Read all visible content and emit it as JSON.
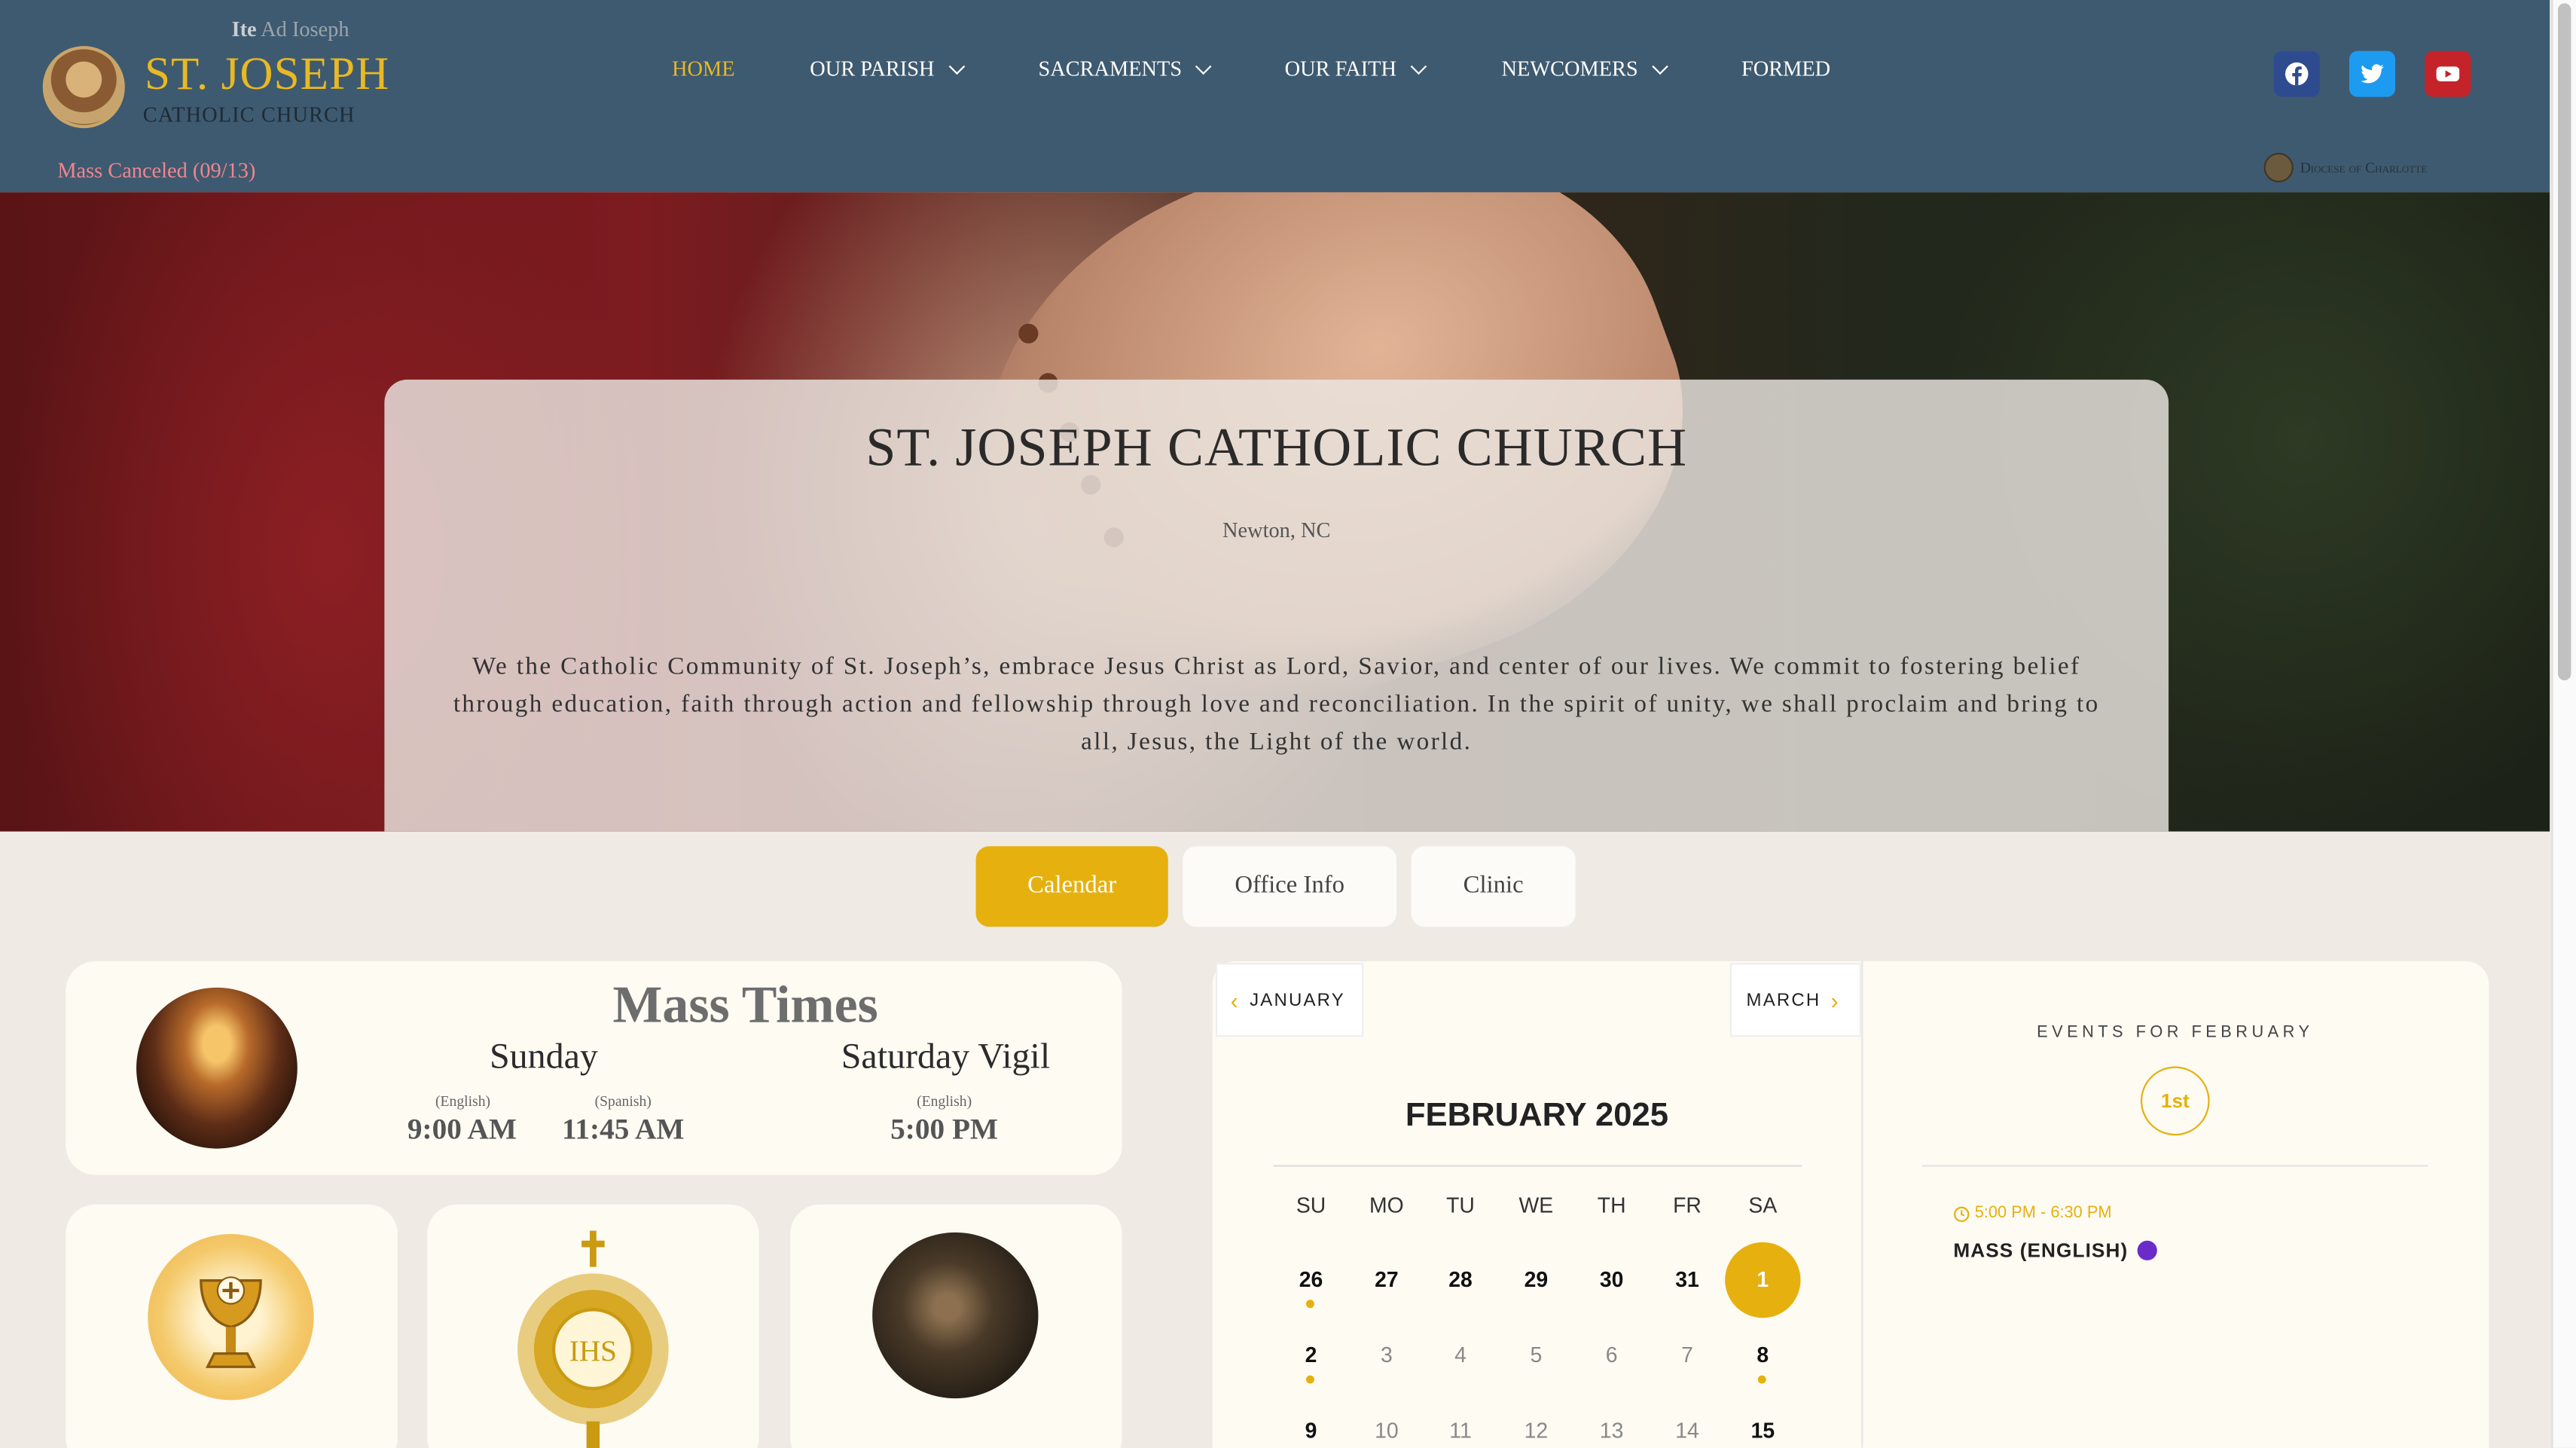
{
  "header": {
    "motto_bold": "Ite",
    "motto_rest": " Ad Ioseph",
    "logo_title": "ST. JOSEPH",
    "logo_subtitle": "CATHOLIC CHURCH",
    "notice": "Mass Canceled (09/13)",
    "diocese": "Diocese of Charlotte"
  },
  "nav": [
    {
      "label": "HOME",
      "active": true
    },
    {
      "label": "OUR PARISH",
      "dropdown": true
    },
    {
      "label": "SACRAMENTS",
      "dropdown": true
    },
    {
      "label": "OUR FAITH",
      "dropdown": true
    },
    {
      "label": "NEWCOMERS",
      "dropdown": true
    },
    {
      "label": "FORMED"
    }
  ],
  "social": [
    {
      "icon": "facebook-icon",
      "color": "#2f4b8f"
    },
    {
      "icon": "twitter-icon",
      "color": "#1d9bf0"
    },
    {
      "icon": "youtube-icon",
      "color": "#c4232a"
    }
  ],
  "hero": {
    "title": "ST. JOSEPH CATHOLIC CHURCH",
    "location": "Newton, NC",
    "mission": "We the Catholic Community of St. Joseph’s, embrace Jesus Christ as Lord, Savior, and center of our lives. We commit to fostering belief through education, faith through action and fellowship through love and reconciliation.  In the spirit of unity, we shall proclaim and bring to all, Jesus, the Light of the world."
  },
  "tabs": [
    {
      "label": "Calendar",
      "active": true
    },
    {
      "label": "Office Info"
    },
    {
      "label": "Clinic"
    }
  ],
  "mass_times": {
    "title": "Mass Times",
    "sunday": "Sunday",
    "saturday": "Saturday Vigil",
    "sun_english_label": "(English)",
    "sun_spanish_label": "(Spanish)",
    "sat_english_label": "(English)",
    "sun_english_time": "9:00 AM",
    "sun_spanish_time": "11:45 AM",
    "sat_english_time": "5:00 PM"
  },
  "monstrance_text": "IHS",
  "calendar": {
    "prev": "JANUARY",
    "next": "MARCH",
    "month": "FEBRUARY 2025",
    "weekdays": [
      "SU",
      "MO",
      "TU",
      "WE",
      "TH",
      "FR",
      "SA"
    ],
    "rows": [
      [
        "26",
        "27",
        "28",
        "29",
        "30",
        "31",
        "1"
      ],
      [
        "2",
        "3",
        "4",
        "5",
        "6",
        "7",
        "8"
      ],
      [
        "9",
        "10",
        "11",
        "12",
        "13",
        "14",
        "15"
      ]
    ],
    "events_heading": "EVENTS FOR FEBRUARY",
    "selected_day": "1st",
    "event_time": "5:00 PM - 6:30 PM",
    "event_name": "MASS (ENGLISH)",
    "accent": "#e6b00f"
  }
}
